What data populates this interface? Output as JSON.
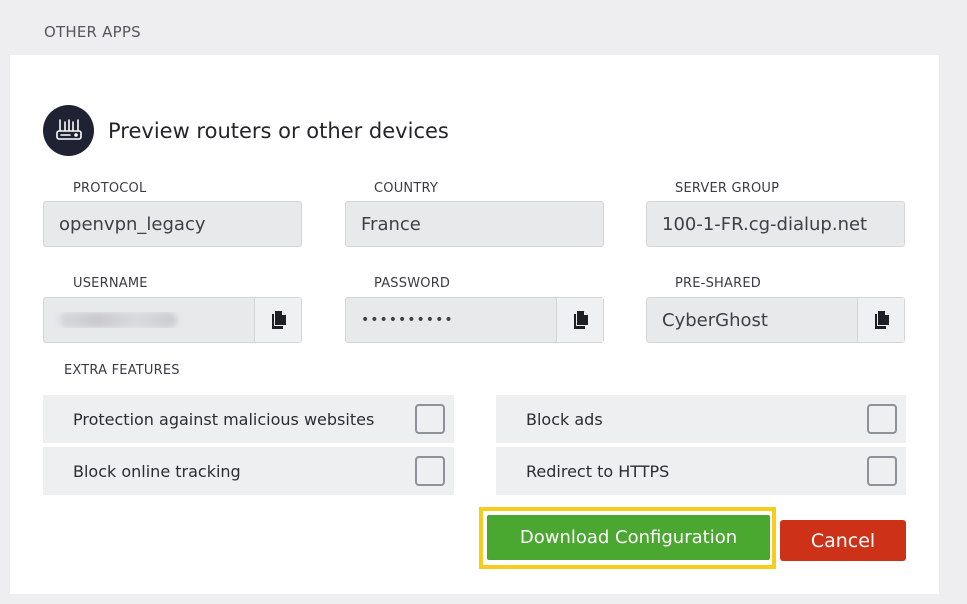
{
  "section": {
    "title": "OTHER APPS"
  },
  "panel": {
    "heading": "Preview routers or other devices"
  },
  "fields": {
    "protocol": {
      "label": "PROTOCOL",
      "value": "openvpn_legacy"
    },
    "country": {
      "label": "COUNTRY",
      "value": "France"
    },
    "server_group": {
      "label": "SERVER GROUP",
      "value": "100-1-FR.cg-dialup.net"
    },
    "username": {
      "label": "USERNAME"
    },
    "password": {
      "label": "PASSWORD",
      "value": "••••••••••"
    },
    "preshared": {
      "label": "PRE-SHARED",
      "value": "CyberGhost"
    }
  },
  "extra_features": {
    "label": "EXTRA FEATURES",
    "options": [
      {
        "label": "Protection against malicious websites",
        "checked": false
      },
      {
        "label": "Block ads",
        "checked": false
      },
      {
        "label": "Block online tracking",
        "checked": false
      },
      {
        "label": "Redirect to HTTPS",
        "checked": false
      }
    ]
  },
  "actions": {
    "download_label": "Download Configuration",
    "cancel_label": "Cancel",
    "download_highlight_color": "#f6cd1d"
  },
  "icons": {
    "device": "router-icon",
    "copy": "copy-icon"
  }
}
